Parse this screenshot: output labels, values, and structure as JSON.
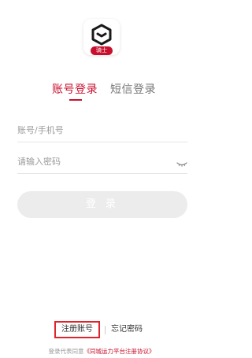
{
  "app": {
    "badge_text": "骑士",
    "brand_color": "#c8102e"
  },
  "tabs": [
    {
      "label": "账号登录",
      "active": true
    },
    {
      "label": "短信登录",
      "active": false
    }
  ],
  "form": {
    "account_placeholder": "账号/手机号",
    "account_value": "",
    "password_placeholder": "请输入密码",
    "password_value": "",
    "password_toggle_icon": "eye-closed-icon",
    "login_label": "登 录"
  },
  "links": {
    "register_label": "注册账号",
    "forgot_label": "忘记密码"
  },
  "agreement": {
    "prefix": "登录代表同意",
    "link_text": "《同城运力平台注册协议》"
  }
}
